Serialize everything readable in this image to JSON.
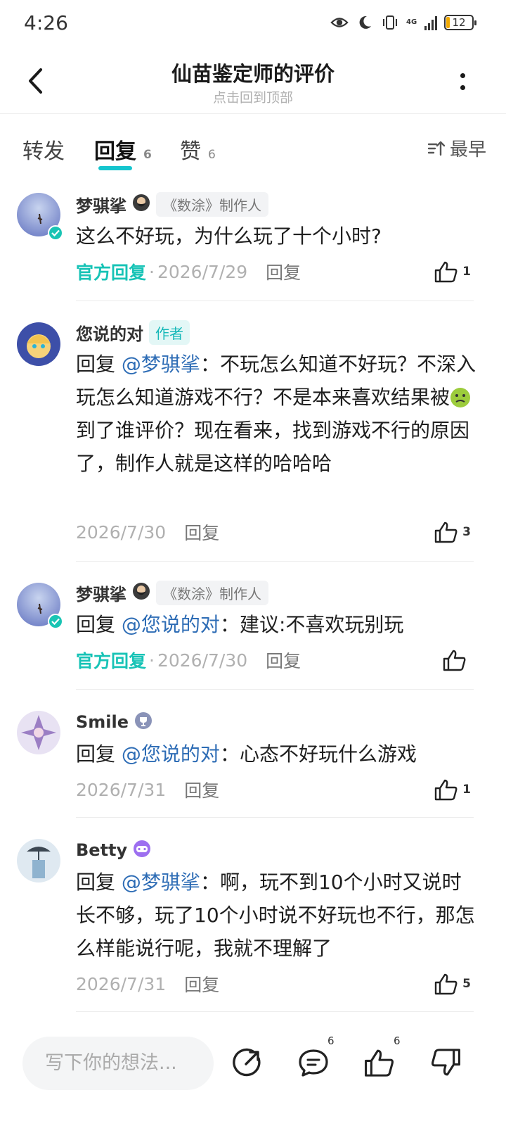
{
  "status_bar": {
    "time": "4:26",
    "battery": "12",
    "network": "4G"
  },
  "header": {
    "title": "仙苗鉴定师的评价",
    "subtitle": "点击回到顶部"
  },
  "tabs": [
    {
      "label": "转发",
      "count": ""
    },
    {
      "label": "回复",
      "count": "6"
    },
    {
      "label": "赞",
      "count": "6"
    }
  ],
  "sort_label": "最早",
  "comments": [
    {
      "name": "梦骐挲",
      "tag": "《数涂》制作人",
      "official": "官方回复",
      "mention": "",
      "text": "这么不好玩，为什么玩了十个小时?",
      "date": "2026/7/29",
      "reply": "回复",
      "likes": "1"
    },
    {
      "name": "您说的对",
      "tag": "作者",
      "prefix": "回复",
      "mention": "@梦骐挲",
      "text_a": "：不玩怎么知道不好玩？不深入玩怎么知道游戏不行？不是本来喜欢结果被",
      "text_b": "到了谁评价？现在看来，找到游戏不行的原因了，制作人就是这样的哈哈哈",
      "date": "2026/7/30",
      "reply": "回复",
      "likes": "3"
    },
    {
      "name": "梦骐挲",
      "tag": "《数涂》制作人",
      "official": "官方回复",
      "prefix": "回复",
      "mention": "@您说的对",
      "text": "：建议:不喜欢玩别玩",
      "date": "2026/7/30",
      "reply": "回复",
      "likes": ""
    },
    {
      "name": "Smile",
      "prefix": "回复",
      "mention": "@您说的对",
      "text": "：心态不好玩什么游戏",
      "date": "2026/7/31",
      "reply": "回复",
      "likes": "1"
    },
    {
      "name": "Betty",
      "prefix": "回复",
      "mention": "@梦骐挲",
      "text": "：啊，玩不到10个小时又说时长不够，玩了10个小时说不好玩也不行，那怎么样能说行呢，我就不理解了",
      "date": "2026/7/31",
      "reply": "回复",
      "likes": "5"
    }
  ],
  "bottom_bar": {
    "input_placeholder": "写下你的想法...",
    "comment_count": "6",
    "like_count": "6"
  },
  "colors": {
    "accent": "#15c5ce",
    "official": "#17c3b6",
    "mention": "#2d6cb5"
  }
}
